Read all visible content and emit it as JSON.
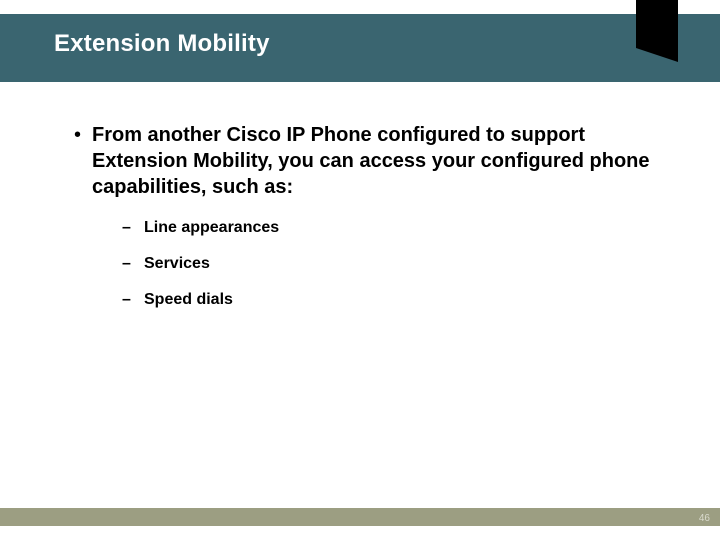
{
  "colors": {
    "header": "#3a6570",
    "footer": "#9c9e82",
    "corner": "#000000"
  },
  "title": "Extension Mobility",
  "bullet": {
    "marker": "•",
    "text": "From another Cisco IP Phone configured to support Extension Mobility, you can access your configured phone capabilities, such as:"
  },
  "sub_marker": "–",
  "sub_items": [
    "Line appearances",
    "Services",
    "Speed dials"
  ],
  "page_number": "46"
}
